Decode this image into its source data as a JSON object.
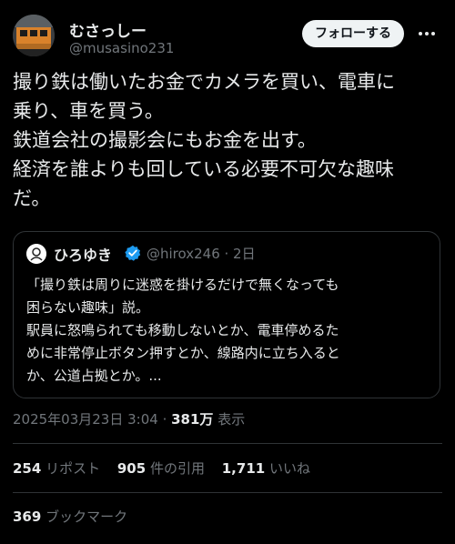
{
  "author": {
    "name": "むさっしー",
    "handle": "@musasino231"
  },
  "header": {
    "follow_label": "フォローする",
    "more_icon": "more-horizontal-icon"
  },
  "tweet": {
    "text": "撮り鉄は働いたお金でカメラを買い、電車に\n乗り、車を買う。\n鉄道会社の撮影会にもお金を出す。\n経済を誰よりも回している必要不可欠な趣味\nだ。"
  },
  "quote": {
    "name": "ひろゆき",
    "verified_icon": "verified-badge-icon",
    "handle_date": "@hirox246 · 2日",
    "text": "「撮り鉄は周りに迷惑を掛けるだけで無くなっても\n困らない趣味」説。\n駅員に怒鳴られても移動しないとか、電車停めるた\nめに非常停止ボタン押すとか、線路内に立ち入ると\nか、公道占拠とか。..."
  },
  "meta": {
    "timestamp": "2025年03月23日 3:04 · ",
    "views_count": "381万",
    "views_label": " 表示"
  },
  "stats": {
    "reposts_count": "254",
    "reposts_label": " リポスト",
    "quotes_count": "905",
    "quotes_label": " 件の引用",
    "likes_count": "1,711",
    "likes_label": " いいね",
    "bookmarks_count": "369",
    "bookmarks_label": " ブックマーク"
  },
  "colors": {
    "background": "#000000",
    "text": "#e7e9ea",
    "secondary": "#71767b",
    "border": "#2f3336",
    "verified": "#1d9bf0",
    "follow_bg": "#eff3f4"
  }
}
